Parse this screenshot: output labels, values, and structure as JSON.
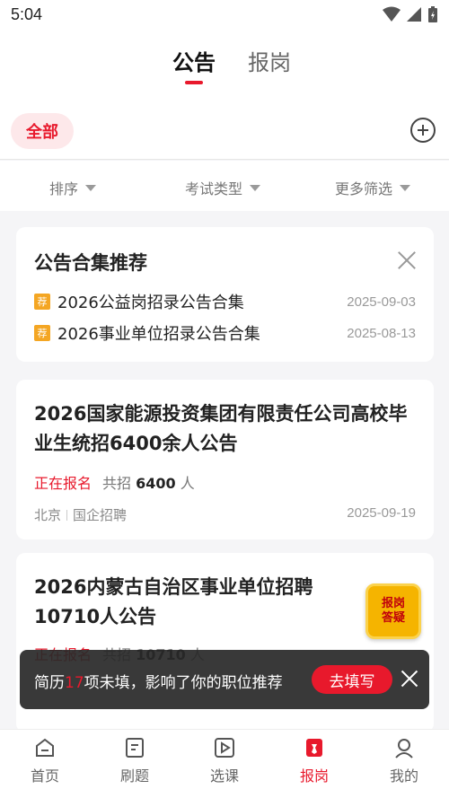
{
  "status_bar": {
    "time": "5:04"
  },
  "top_tabs": [
    {
      "label": "公告"
    },
    {
      "label": "报岗"
    }
  ],
  "chips": {
    "all": "全部"
  },
  "filters": [
    {
      "label": "排序"
    },
    {
      "label": "考试类型"
    },
    {
      "label": "更多筛选"
    }
  ],
  "recommend": {
    "title": "公告合集推荐",
    "items": [
      {
        "badge": "荐",
        "text": "2026公益岗招录公告合集",
        "date": "2025-09-03"
      },
      {
        "badge": "荐",
        "text": "2026事业单位招录公告合集",
        "date": "2025-08-13"
      }
    ]
  },
  "jobs": [
    {
      "title": "2026国家能源投资集团有限责任公司高校毕业生统招6400余人公告",
      "status": "正在报名",
      "recruit_prefix": "共招",
      "recruit_count": "6400",
      "recruit_unit": "人",
      "location": "北京",
      "category": "国企招聘",
      "date": "2025-09-19"
    },
    {
      "title": "2026内蒙古自治区事业单位招聘10710人公告",
      "status": "正在报名",
      "recruit_prefix": "共招",
      "recruit_count": "10710",
      "recruit_unit": "人"
    }
  ],
  "toast": {
    "prefix": "简历",
    "count": "17",
    "suffix": "项未填，影响了你的职位推荐",
    "button": "去填写"
  },
  "faq_badge": {
    "line1": "报岗",
    "line2": "答疑"
  },
  "bottom_tabs": [
    {
      "label": "首页",
      "icon": "home-icon"
    },
    {
      "label": "刷题",
      "icon": "quiz-icon"
    },
    {
      "label": "选课",
      "icon": "play-icon"
    },
    {
      "label": "报岗",
      "icon": "job-icon"
    },
    {
      "label": "我的",
      "icon": "profile-icon"
    }
  ],
  "colors": {
    "accent": "#e8192c",
    "badge": "#f4a623"
  }
}
